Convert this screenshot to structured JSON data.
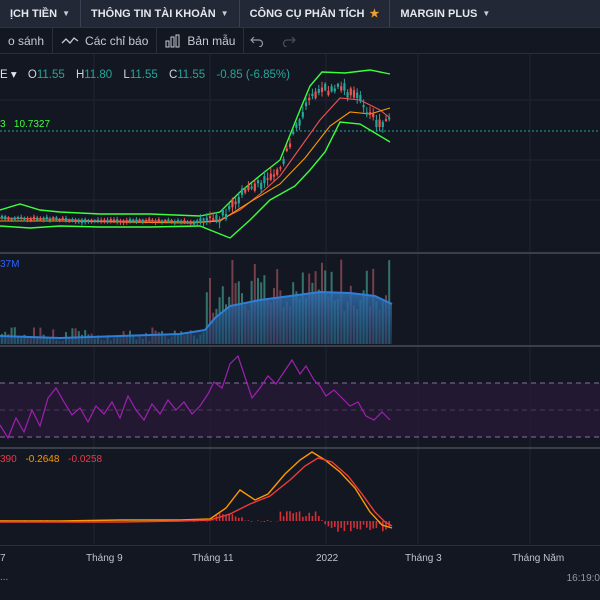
{
  "topnav": {
    "items": [
      {
        "label": "ỊCH TIỀN",
        "marker": "caret"
      },
      {
        "label": "THÔNG TIN TÀI KHOẢN",
        "marker": "caret"
      },
      {
        "label": "CÔNG CỤ PHÂN TÍCH",
        "marker": "star"
      },
      {
        "label": "MARGIN PLUS",
        "marker": "caret"
      }
    ]
  },
  "toolbar": {
    "compare_label": "o sánh",
    "indicators_label": "Các chỉ báo",
    "templates_label": "Bản mẫu"
  },
  "legend": {
    "symbol_fragment": "E",
    "open_label": "O",
    "open_value": "11.55",
    "high_label": "H",
    "high_value": "11.80",
    "low_label": "L",
    "low_value": "11.55",
    "close_label": "C",
    "close_value": "11.55",
    "change": "-0.85 (-6.85%)"
  },
  "bollinger_legend": {
    "prefix": "3",
    "value": "10.7327"
  },
  "volume_legend": {
    "value": "37M"
  },
  "macd_legend": {
    "macd": "390",
    "signal": "-0.2648",
    "histogram": "-0.0258"
  },
  "time_axis": {
    "labels": [
      "7",
      "Tháng 9",
      "Tháng 11",
      "2022",
      "Tháng 3",
      "Tháng Năm"
    ]
  },
  "status": {
    "clock": "16:19:0",
    "dots": "..."
  },
  "colors": {
    "up": "#26a69a",
    "down": "#ef5350",
    "bb_band": "#3cff3c",
    "bb_mid": "#ef5350",
    "ma": "#ff9800",
    "rsi": "#9c27b0",
    "volume_ma": "#2962ff"
  },
  "chart_data": {
    "type": "candlestick",
    "x_labels": [
      "7",
      "Tháng 9",
      "Tháng 11",
      "2022",
      "Tháng 3",
      "Tháng Năm"
    ],
    "last_close": 11.55,
    "indicators": [
      "Bollinger Bands",
      "Volume",
      "RSI",
      "MACD"
    ]
  }
}
